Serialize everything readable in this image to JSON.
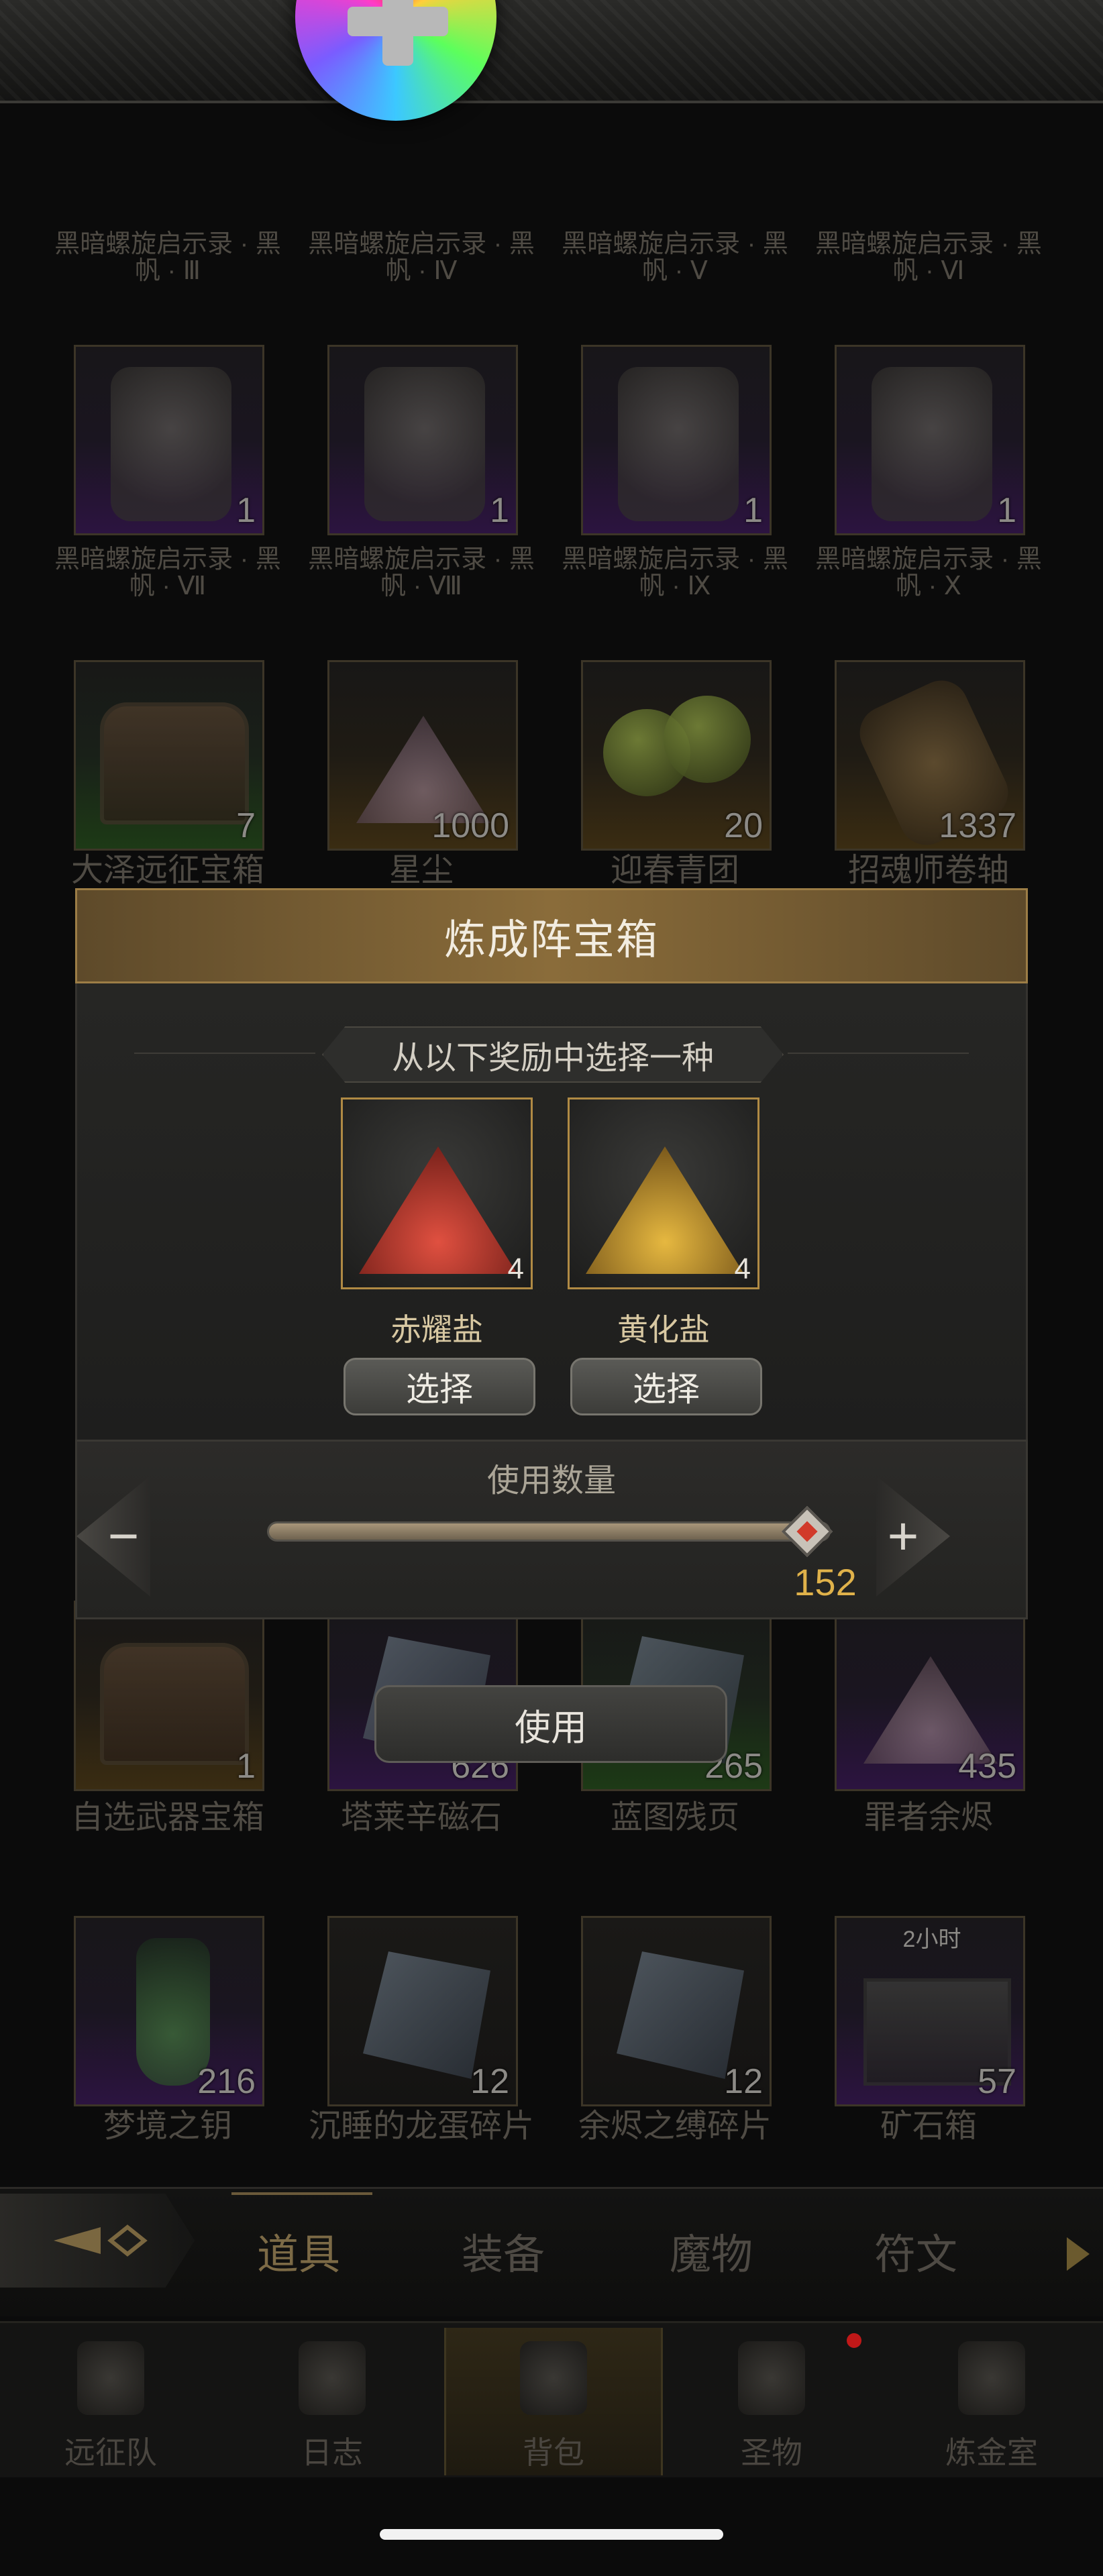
{
  "grid": {
    "row0_labels": [
      "黑暗螺旋启示录 · 黑帆 · Ⅲ",
      "黑暗螺旋启示录 · 黑帆 · Ⅳ",
      "黑暗螺旋启示录 · 黑帆 · Ⅴ",
      "黑暗螺旋启示录 · 黑帆 · Ⅵ"
    ],
    "row1": [
      {
        "label": "黑暗螺旋启示录 · 黑帆 · Ⅶ",
        "count": "1"
      },
      {
        "label": "黑暗螺旋启示录 · 黑帆 · Ⅷ",
        "count": "1"
      },
      {
        "label": "黑暗螺旋启示录 · 黑帆 · Ⅸ",
        "count": "1"
      },
      {
        "label": "黑暗螺旋启示录 · 黑帆 · Ⅹ",
        "count": "1"
      }
    ],
    "row2": [
      {
        "label": "大泽远征宝箱",
        "count": "7"
      },
      {
        "label": "星尘",
        "count": "1000"
      },
      {
        "label": "迎春青团",
        "count": "20"
      },
      {
        "label": "招魂师卷轴",
        "count": "1337"
      }
    ],
    "row3": [
      {
        "label": "自选武器宝箱",
        "count": "1"
      },
      {
        "label": "塔莱辛磁石",
        "count": "626"
      },
      {
        "label": "蓝图残页",
        "count": "265"
      },
      {
        "label": "罪者余烬",
        "count": "435"
      }
    ],
    "row4": [
      {
        "label": "梦境之钥",
        "count": "216"
      },
      {
        "label": "沉睡的龙蛋碎片",
        "count": "12"
      },
      {
        "label": "余烬之缚碎片",
        "count": "12"
      },
      {
        "label": "矿石箱",
        "count": "57",
        "timer": "2小时"
      }
    ]
  },
  "dialog": {
    "title": "炼成阵宝箱",
    "subtitle": "从以下奖励中选择一种",
    "rewards": [
      {
        "name": "赤耀盐",
        "count": "4",
        "color": "#c83a2a"
      },
      {
        "name": "黄化盐",
        "count": "4",
        "color": "#c89a2a"
      }
    ],
    "select_label": "选择",
    "quantity_label": "使用数量",
    "minus": "−",
    "plus": "+",
    "quantity_value": "152",
    "quantity_fraction": 1.0,
    "use_label": "使用"
  },
  "tabs": {
    "items": [
      "道具",
      "装备",
      "魔物",
      "符文"
    ],
    "active": "道具"
  },
  "nav": {
    "items": [
      "远征队",
      "日志",
      "背包",
      "圣物",
      "炼金室"
    ],
    "active": "背包"
  },
  "colors": {
    "accent_gold": "#b08a44",
    "quantity_text": "#e0b24a",
    "notification": "#c01818"
  }
}
